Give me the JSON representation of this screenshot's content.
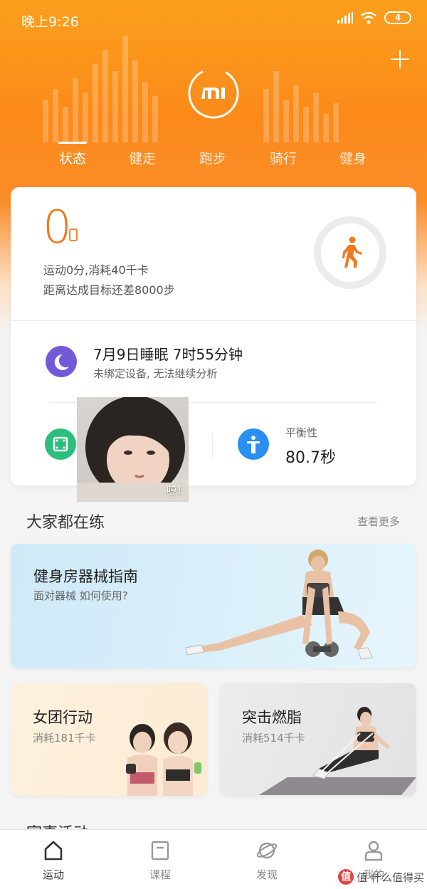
{
  "status_bar": {
    "time": "晚上9:26",
    "battery": "4"
  },
  "header": {
    "tabs": [
      {
        "label": "状态",
        "active": true
      },
      {
        "label": "健走",
        "active": false
      },
      {
        "label": "跑步",
        "active": false
      },
      {
        "label": "骑行",
        "active": false
      },
      {
        "label": "健身",
        "active": false
      }
    ]
  },
  "summary": {
    "steps": "0",
    "line1": "运动0分,消耗40千卡",
    "line2": "距离达成目标还差8000步"
  },
  "sleep": {
    "title": "7月9日睡眠  7时55分钟",
    "subtitle": "未绑定设备, 无法继续分析"
  },
  "balance": {
    "label": "平衡性",
    "value": "80.7秒"
  },
  "overlay": {
    "caption": "哼!"
  },
  "section": {
    "title": "大家都在练",
    "see_more": "查看更多"
  },
  "banner": {
    "title": "健身房器械指南",
    "subtitle": "面对器械 如何使用?"
  },
  "tiles": [
    {
      "title": "女团行动",
      "subtitle": "消耗181千卡"
    },
    {
      "title": "突击燃脂",
      "subtitle": "消耗514千卡"
    }
  ],
  "next_section": {
    "title": "室事活动"
  },
  "bottom_nav": [
    {
      "label": "运动",
      "icon": "home-icon",
      "active": true
    },
    {
      "label": "课程",
      "icon": "course-icon",
      "active": false
    },
    {
      "label": "发现",
      "icon": "planet-icon",
      "active": false
    },
    {
      "label": "我的",
      "icon": "profile-icon",
      "active": false
    }
  ],
  "watermark": {
    "text": "值 什么值得买",
    "badge": "值"
  },
  "colors": {
    "accent": "#f07a1c",
    "header": "#fb8a1a",
    "sleep": "#7458d8",
    "green": "#2bbf7e",
    "blue": "#2a8ef2"
  }
}
